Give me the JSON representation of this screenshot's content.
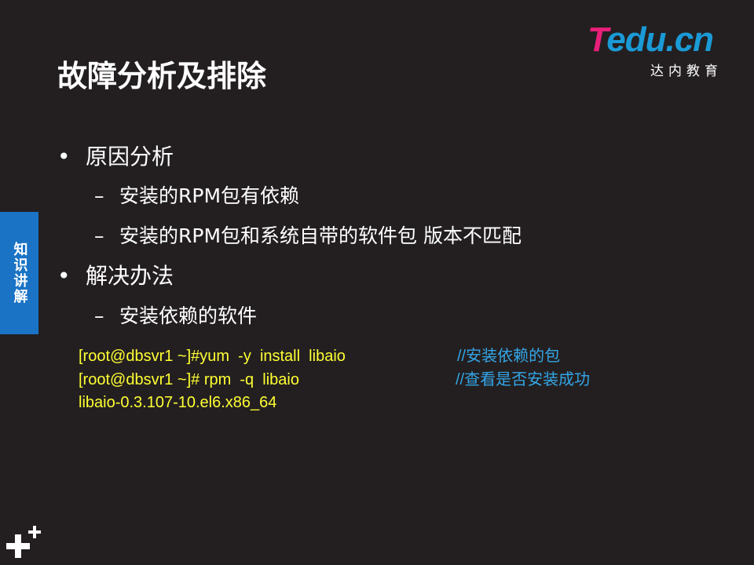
{
  "logo": {
    "word_t": "T",
    "word_rest": "edu.cn",
    "subtitle": "达内教育"
  },
  "slide": {
    "title": "故障分析及排除",
    "side_tab": "知识讲解"
  },
  "bullets": [
    {
      "marker": "•",
      "text": "原因分析"
    },
    {
      "marker": "–",
      "text": "安装的RPM包有依赖"
    },
    {
      "marker": "–",
      "text": "安装的RPM包和系统自带的软件包  版本不匹配"
    },
    {
      "marker": "•",
      "text": "解决办法"
    },
    {
      "marker": "–",
      "text": "安装依赖的软件"
    }
  ],
  "code": [
    {
      "command": "[root@dbsvr1 ~]#yum  -y  install  libaio",
      "comment": "//安装依赖的包"
    },
    {
      "command": "[root@dbsvr1 ~]# rpm  -q  libaio",
      "comment": "//查看是否安装成功"
    },
    {
      "command": "libaio-0.3.107-10.el6.x86_64",
      "comment": ""
    }
  ],
  "colors": {
    "background": "#231f20",
    "side_tab": "#1a73c5",
    "command": "#ffff33",
    "comment": "#33a6e8",
    "logo_pink": "#e8207a",
    "logo_blue": "#1a9ad6"
  },
  "icons": [
    "plus-icon"
  ]
}
